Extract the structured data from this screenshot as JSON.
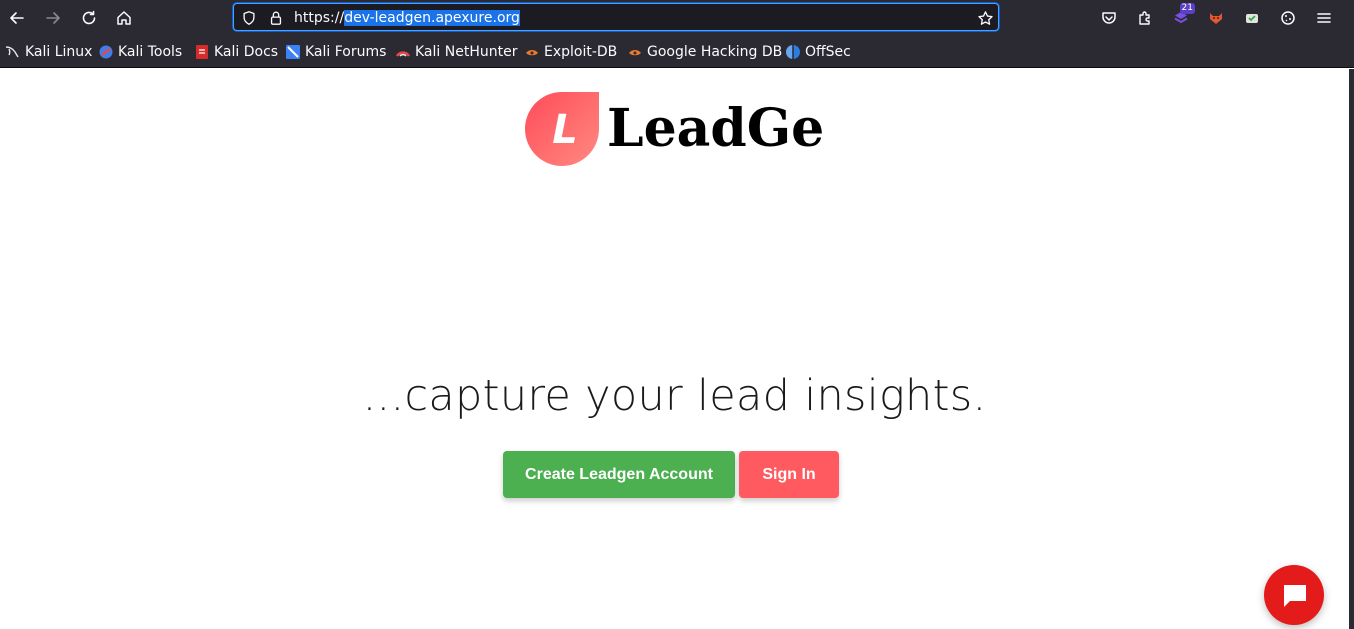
{
  "browser": {
    "url_prefix": "https://",
    "url_domain": "dev-leadgen.apexure.org",
    "extension_badge": "21"
  },
  "bookmarks": [
    {
      "label": "Kali Linux",
      "icon": "kali-dragon-icon"
    },
    {
      "label": "Kali Tools",
      "icon": "kali-tools-icon"
    },
    {
      "label": "Kali Docs",
      "icon": "kali-docs-icon"
    },
    {
      "label": "Kali Forums",
      "icon": "kali-forums-icon"
    },
    {
      "label": "Kali NetHunter",
      "icon": "kali-nethunter-icon"
    },
    {
      "label": "Exploit-DB",
      "icon": "exploit-db-icon"
    },
    {
      "label": "Google Hacking DB",
      "icon": "ghdb-icon"
    },
    {
      "label": "OffSec",
      "icon": "offsec-icon"
    }
  ],
  "page": {
    "logo_text": "LeadGe",
    "logo_letter": "L",
    "tagline": "...capture your lead insights.",
    "create_button": "Create Leadgen Account",
    "signin_button": "Sign In"
  },
  "colors": {
    "green_button": "#4caf50",
    "red_button": "#ff5a5f",
    "chat_button": "#e31b1b",
    "url_selection": "#1a73e8"
  }
}
